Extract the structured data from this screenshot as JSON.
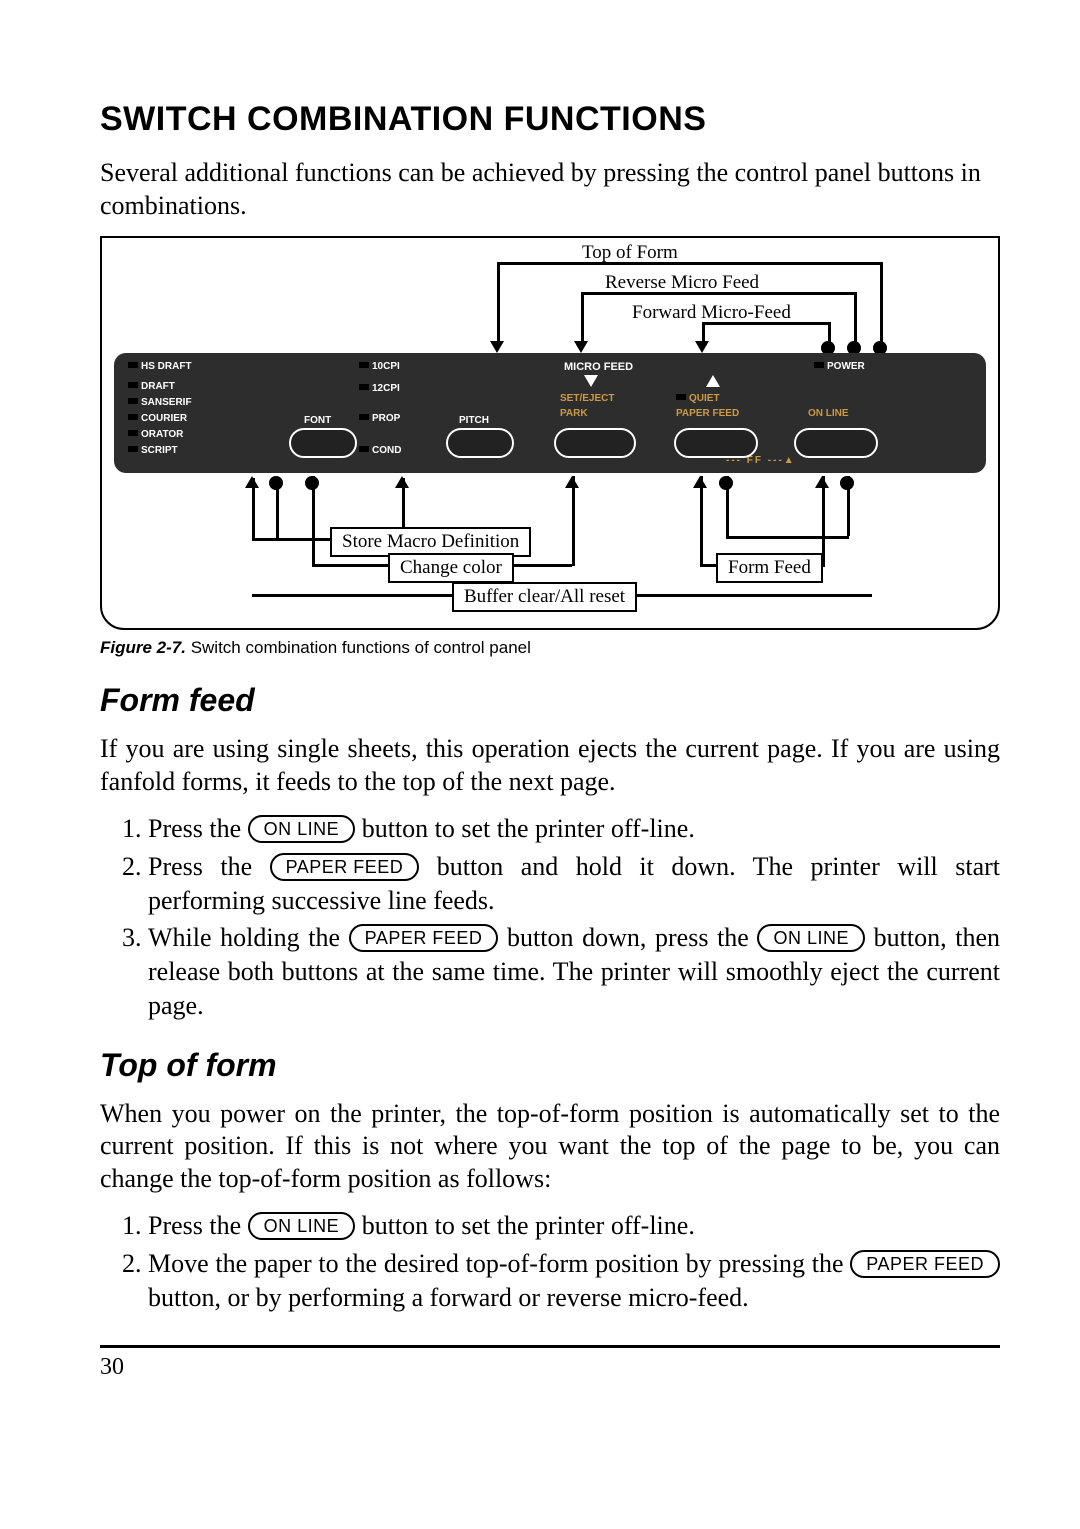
{
  "title": "SWITCH COMBINATION FUNCTIONS",
  "intro": "Several additional functions can be achieved by pressing the control panel buttons in combinations.",
  "figure": {
    "caption_label": "Figure 2-7.",
    "caption_text": " Switch combination functions of control panel",
    "top_of_form": "Top of Form",
    "rev_micro": "Reverse Micro Feed",
    "fwd_micro": "Forward Micro-Feed",
    "store_macro": "Store Macro Definition",
    "change_color": "Change color",
    "form_feed": "Form Feed",
    "buffer_reset": "Buffer clear/All reset",
    "panel": {
      "hs_draft": "HS DRAFT",
      "draft": "DRAFT",
      "sanserif": "SANSERIF",
      "courier": "COURIER",
      "orator": "ORATOR",
      "script": "SCRIPT",
      "cpi10": "10CPI",
      "cpi12": "12CPI",
      "prop": "PROP",
      "cond": "COND",
      "font": "FONT",
      "pitch": "PITCH",
      "micro_feed": "MICRO FEED",
      "set_eject": "SET/EJECT",
      "park": "PARK",
      "quiet": "QUIET",
      "paper_feed": "PAPER FEED",
      "power": "POWER",
      "online": "ON LINE",
      "ff": "FF"
    }
  },
  "section1": {
    "heading": "Form feed",
    "intro": "If you are using single sheets, this operation ejects the current page. If you are using fanfold forms, it feeds to the top of the next page.",
    "s1a": "Press the ",
    "s1b": " button to set the printer off-line.",
    "s2a": "Press the ",
    "s2b": " button and hold it down. The printer will start performing successive line feeds.",
    "s3a": "While holding the ",
    "s3b": " button down, press the ",
    "s3c": " button, then release both buttons at the same time. The printer will smoothly eject the current page."
  },
  "section2": {
    "heading": "Top of form",
    "intro": "When you power on the printer, the top-of-form position is automatically set to the current position. If this is not where you want the top of the page to be, you can change the top-of-form position as follows:",
    "s1a": "Press the ",
    "s1b": " button to set the printer off-line.",
    "s2a": "Move the paper to the desired top-of-form position by pressing the ",
    "s2b": " button, or by performing a forward or reverse micro-feed."
  },
  "buttons": {
    "online": "ON LINE",
    "paperfeed": "PAPER FEED"
  },
  "page_number": "30"
}
